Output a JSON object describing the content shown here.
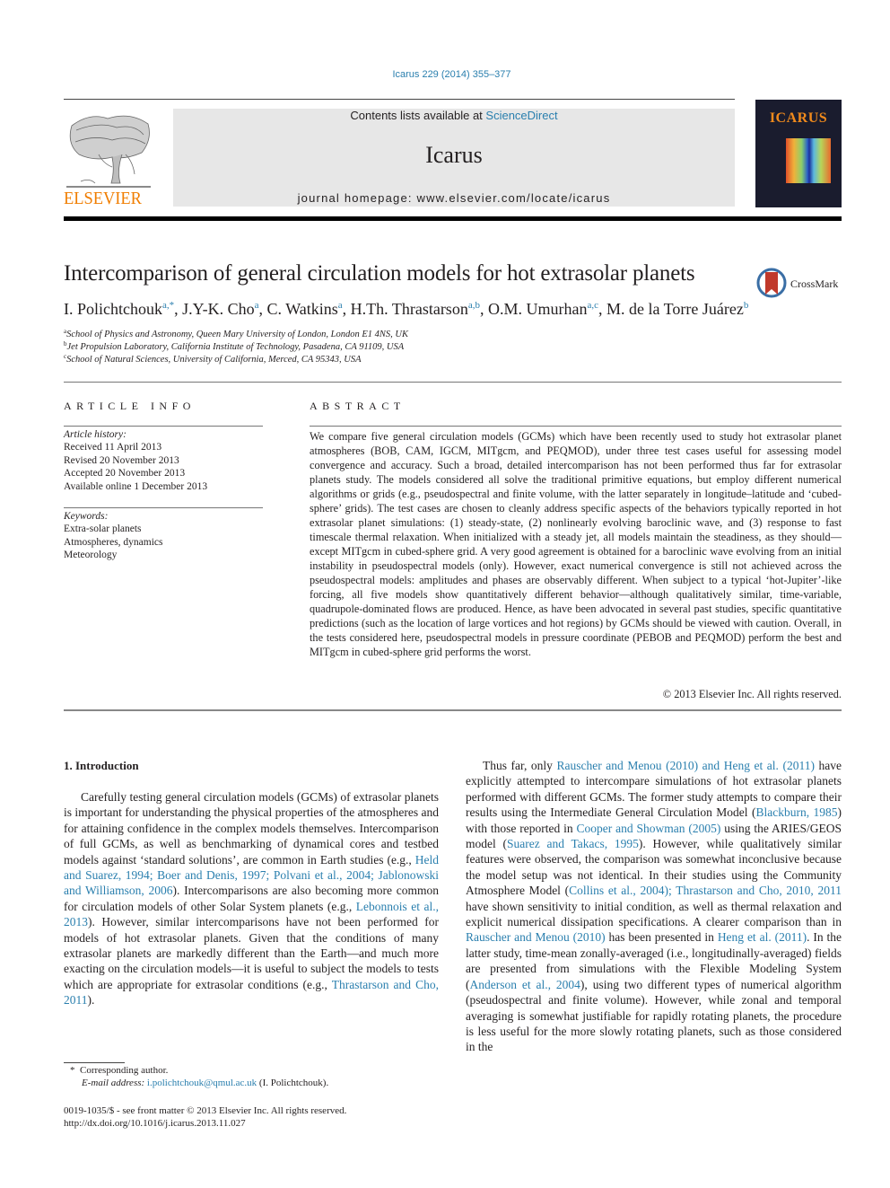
{
  "header": {
    "citation": "Icarus 229 (2014) 355–377",
    "contents_prefix": "Contents lists available at ",
    "contents_link": "ScienceDirect",
    "journal_name": "Icarus",
    "homepage": "journal homepage: www.elsevier.com/locate/icarus",
    "publisher_logo_text": "ELSEVIER",
    "cover_title": "ICARUS",
    "colors": {
      "link": "#2a7fae",
      "elsevier_orange": "#f07d00",
      "box_gray": "#e7e7e7"
    }
  },
  "article": {
    "title": "Intercomparison of general circulation models for hot extrasolar planets",
    "crossmark_label": "CrossMark",
    "authors": [
      {
        "name": "I. Polichtchouk",
        "sup": "a,*"
      },
      {
        "name": "J.Y-K. Cho",
        "sup": "a"
      },
      {
        "name": "C. Watkins",
        "sup": "a"
      },
      {
        "name": "H.Th. Thrastarson",
        "sup": "a,b"
      },
      {
        "name": "O.M. Umurhan",
        "sup": "a,c"
      },
      {
        "name": "M. de la Torre Juárez",
        "sup": "b"
      }
    ],
    "affiliations": [
      {
        "key": "a",
        "text": "School of Physics and Astronomy, Queen Mary University of London, London E1 4NS, UK"
      },
      {
        "key": "b",
        "text": "Jet Propulsion Laboratory, California Institute of Technology, Pasadena, CA 91109, USA"
      },
      {
        "key": "c",
        "text": "School of Natural Sciences, University of California, Merced, CA 95343, USA"
      }
    ]
  },
  "article_info": {
    "heading": "ARTICLE INFO",
    "history_label": "Article history:",
    "history": [
      "Received 11 April 2013",
      "Revised 20 November 2013",
      "Accepted 20 November 2013",
      "Available online 1 December 2013"
    ],
    "keywords_label": "Keywords:",
    "keywords": [
      "Extra-solar planets",
      "Atmospheres, dynamics",
      "Meteorology"
    ]
  },
  "abstract": {
    "heading": "ABSTRACT",
    "text": "We compare five general circulation models (GCMs) which have been recently used to study hot extrasolar planet atmospheres (BOB, CAM, IGCM, MITgcm, and PEQMOD), under three test cases useful for assessing model convergence and accuracy. Such a broad, detailed intercomparison has not been per­formed thus far for extrasolar planets study. The models considered all solve the traditional primitive equations, but employ different numerical algorithms or grids (e.g., pseudospectral and finite volume, with the latter separately in longitude–latitude and ‘cubed-sphere’ grids). The test cases are chosen to cleanly address specific aspects of the behaviors typically reported in hot extrasolar planet simulations: (1) steady-state, (2) nonlinearly evolving baroclinic wave, and (3) response to fast timescale thermal relaxation. When initialized with a steady jet, all models maintain the steadiness, as they should—except MITgcm in cubed-sphere grid. A very good agreement is obtained for a baroclinic wave evolving from an initial instability in pseudospectral models (only). However, exact numerical convergence is still not achieved across the pseudospectral models: amplitudes and phases are observably different. When subject to a typical ‘hot-Jupiter’-like forcing, all five models show quantitatively different behavior—although qualitatively similar, time-variable, quadrupole-dominated flows are produced. Hence, as have been advocated in several past studies, specific quantitative predictions (such as the location of large vortices and hot regions) by GCMs should be viewed with caution. Overall, in the tests considered here, pseudospectral models in pressure coordinate (PEBOB and PEQMOD) perform the best and MITgcm in cubed-sphere grid performs the worst.",
    "copyright": "© 2013 Elsevier Inc. All rights reserved."
  },
  "body": {
    "section_heading": "1. Introduction",
    "left_paragraph": [
      {
        "t": "Carefully testing general circulation models (GCMs) of extraso­lar planets is important for understanding the physical properties of the atmospheres and for attaining confidence in the complex models themselves. Intercomparison of full GCMs, as well as benchmarking of dynamical cores and testbed models against ‘standard solutions’, are common in Earth studies (e.g., "
      },
      {
        "link": "Held and Suarez, 1994; Boer and Denis, 1997; Polvani et al., 2004; Jablonow­ski and Williamson, 2006"
      },
      {
        "t": "). Intercomparisons are also becoming more common for circulation models of other Solar System planets (e.g., "
      },
      {
        "link": "Lebonnois et al., 2013"
      },
      {
        "t": "). However, similar intercomparisons have not been performed for models of hot extrasolar planets. Given that the conditions of many extrasolar planets are markedly different than the Earth—and much more exacting on the circula­tion models—it is useful to subject the models to tests which are appropriate for extrasolar conditions (e.g., "
      },
      {
        "link": "Thrastarson and Cho, 2011"
      },
      {
        "t": ")."
      }
    ],
    "right_paragraph": [
      {
        "t": "Thus far, only "
      },
      {
        "link": "Rauscher and Menou (2010) and Heng et al. (2011)"
      },
      {
        "t": " have explicitly attempted to intercompare simulations of hot extrasolar planets performed with different GCMs. The former study attempts to compare their results using the Intermediate General Circulation Model ("
      },
      {
        "link": "Blackburn, 1985"
      },
      {
        "t": ") with those reported in "
      },
      {
        "link": "Cooper and Showman (2005)"
      },
      {
        "t": " using the ARIES/GEOS model ("
      },
      {
        "link": "Suarez and Takacs, 1995"
      },
      {
        "t": "). However, while qualitatively similar features were observed, the comparison was somewhat inconclu­sive because the model setup was not identical. In their studies using the Community Atmosphere Model ("
      },
      {
        "link": "Collins et al., 2004); Thrastarson and Cho, 2010, 2011"
      },
      {
        "t": " have shown sensitivity to initial condition, as well as thermal relaxation and explicit numerical dissipation specifications. A clearer comparison than in "
      },
      {
        "link": "Rauscher and Menou (2010)"
      },
      {
        "t": " has been presented in "
      },
      {
        "link": "Heng et al. (2011)"
      },
      {
        "t": ". In the latter study, time-mean zonally-averaged (i.e., longitudinally-averaged) fields are presented from simulations with the Flexible Modeling System ("
      },
      {
        "link": "Anderson et al., 2004"
      },
      {
        "t": "), using two different types of numerical algorithm (pseudospectral and finite volume). However, while zonal and temporal averaging is somewhat justifi­able for rapidly rotating planets, the procedure is less useful for the more slowly rotating planets, such as those considered in the"
      }
    ]
  },
  "footnotes": {
    "star": "*",
    "corresponding": "Corresponding author.",
    "email_label": "E-mail address:",
    "email": "i.polichtchouk@qmul.ac.uk",
    "email_owner": " (I. Polichtchouk).",
    "front_matter": "0019-1035/$ - see front matter © 2013 Elsevier Inc. All rights reserved.",
    "doi": "http://dx.doi.org/10.1016/j.icarus.2013.11.027"
  }
}
